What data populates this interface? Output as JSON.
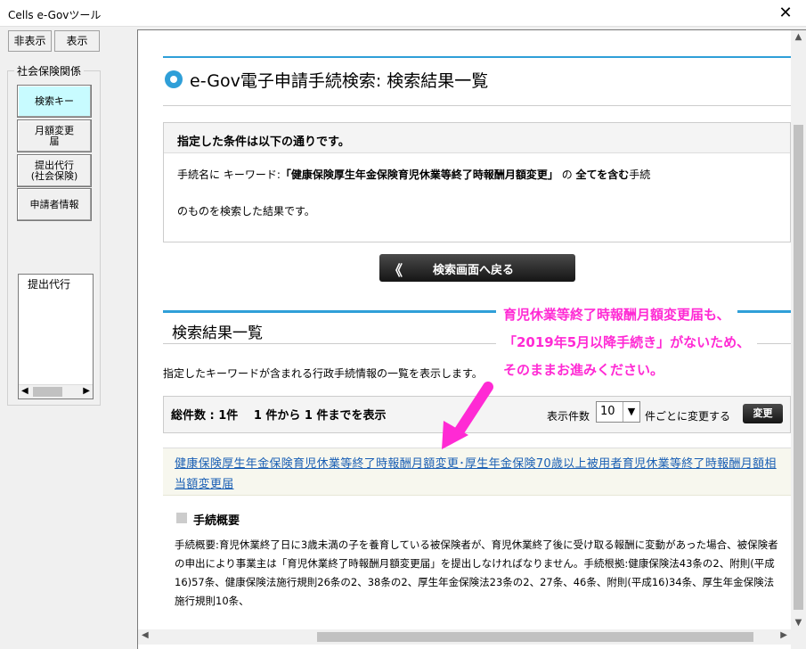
{
  "window": {
    "title": "Cells e-Govツール",
    "close_glyph": "✕"
  },
  "left": {
    "hide_button": "非表示",
    "show_button": "表示",
    "group_label": "社会保険関係",
    "buttons": [
      "検索キー",
      "月額変更\n届",
      "提出代行\n(社会保険)",
      "申請者情報"
    ],
    "list_item": "提出代行"
  },
  "page": {
    "title": "e-Gov電子申請手続検索: 検索結果一覧",
    "cond_head": "指定した条件は以下の通りです。",
    "cond_prefix": "手続名に キーワード:",
    "cond_keyword": "「健康保険厚生年金保険育児休業等終了時報酬月額変更」",
    "cond_suffix_pre": " の ",
    "cond_bold": "全てを含む",
    "cond_suffix": "手続",
    "cond_line2": "のものを検索した結果です。",
    "back_button": "検索画面へ戻る",
    "results_heading": "検索結果一覧",
    "results_desc": "指定したキーワードが含まれる行政手続情報の一覧を表示します。",
    "count_text": "総件数 : 1件　 1 件から 1 件までを表示",
    "per_page_label": "表示件数",
    "per_page_value": "10",
    "per_page_suffix": "件ごとに変更する",
    "change_button": "変更",
    "result_link": "健康保険厚生年金保険育児休業等終了時報酬月額変更･厚生年金保険70歳以上被用者育児休業等終了時報酬月額相当額変更届",
    "summary_heading": "手続概要",
    "summary_text": "手続概要:育児休業終了日に3歳未満の子を養育している被保険者が、育児休業終了後に受け取る報酬に変動があった場合、被保険者の申出により事業主は「育児休業終了時報酬月額変更届」を提出しなければなりません。手続根拠:健康保険法43条の2、附則(平成16)57条、健康保険法施行規則26条の2、38条の2、厚生年金保険法23条の2、27条、46条、附則(平成16)34条、厚生年金保険法施行規則10条、"
  },
  "annotation": {
    "line1": "育児休業等終了時報酬月額変更届も、",
    "line2": "「2019年5月以降手続き」がないため、",
    "line3": "そのままお進みください。",
    "color": "#ff2ad4"
  }
}
